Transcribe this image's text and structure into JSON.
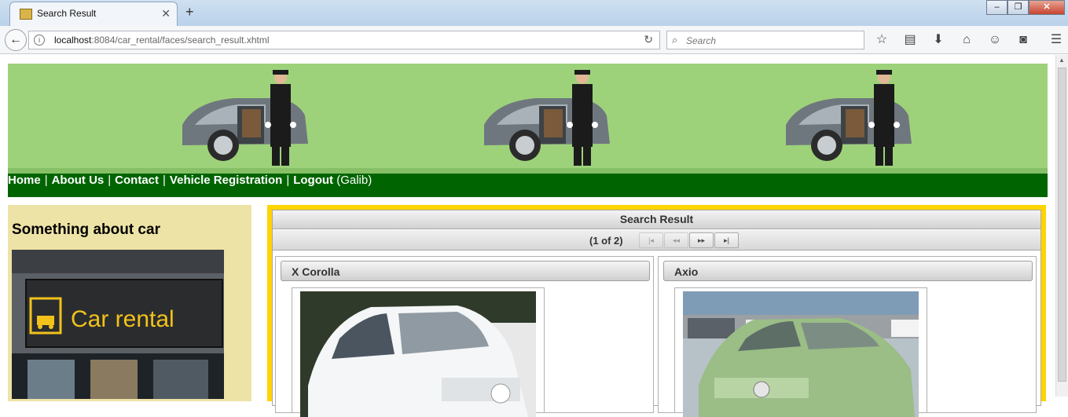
{
  "browser": {
    "tab_title": "Search Result",
    "url_host": "localhost",
    "url_path": ":8084/car_rental/faces/search_result.xhtml",
    "search_placeholder": "Search"
  },
  "menu": {
    "home": "Home",
    "about": "About Us",
    "contact": "Contact",
    "vehicle_registration": "Vehicle Registration",
    "logout": "Logout",
    "user": "(Galib)",
    "separator": "|"
  },
  "sidebar": {
    "heading": "Something about car",
    "sign_text": "Car rental"
  },
  "results": {
    "title": "Search Result",
    "page_info": "(1 of 2)",
    "cars": [
      {
        "name": "X Corolla"
      },
      {
        "name": "Axio"
      }
    ]
  },
  "colors": {
    "banner": "#9dd27a",
    "menu_bar": "#006400",
    "sidebar": "#eee3a6",
    "content_border": "#ffd400"
  }
}
